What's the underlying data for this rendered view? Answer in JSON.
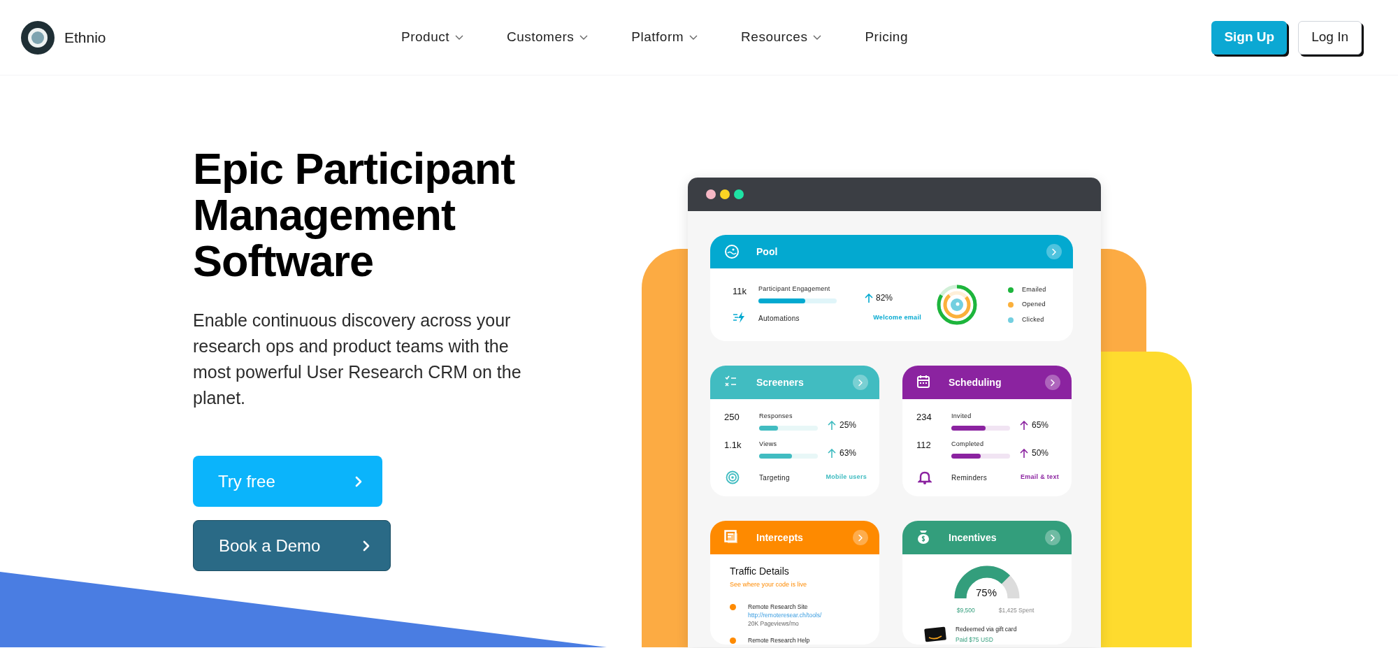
{
  "nav": {
    "brand": "Ethnio",
    "menu": [
      {
        "label": "Product",
        "has_dropdown": true
      },
      {
        "label": "Customers",
        "has_dropdown": true
      },
      {
        "label": "Platform",
        "has_dropdown": true
      },
      {
        "label": "Resources",
        "has_dropdown": true
      },
      {
        "label": "Pricing",
        "has_dropdown": false
      }
    ],
    "actions": [
      {
        "label": "Sign Up",
        "kind": "primary"
      },
      {
        "label": "Log In",
        "kind": "secondary"
      }
    ]
  },
  "hero": {
    "title": "Epic Participant Management Software",
    "description": "Enable continuous discovery across your research ops and product teams with the most powerful User Research CRM on the planet.",
    "buttons": [
      {
        "label": "Try free",
        "kind": "primary"
      },
      {
        "label": "Book a Demo",
        "kind": "secondary"
      }
    ]
  },
  "dashboard": {
    "cards": [
      {
        "kind": "pool",
        "title": "Pool",
        "color": "#03a9d0",
        "value": "11k",
        "label": "Participant Engagement",
        "level": 0.6,
        "change": "82%",
        "footer_label": "Automations",
        "footer_value": "Welcome email",
        "legend": [
          {
            "label": "Emailed",
            "color": "#1db53c"
          },
          {
            "label": "Opened",
            "color": "#fbb03b"
          },
          {
            "label": "Clicked",
            "color": "#73cfe0"
          }
        ]
      },
      {
        "kind": "metrics",
        "title": "Screeners",
        "color": "#41bcc1",
        "metrics": [
          {
            "value": "250",
            "label": "Responses",
            "level": 0.32,
            "change": "25%"
          },
          {
            "value": "1.1k",
            "label": "Views",
            "level": 0.56,
            "change": "63%"
          }
        ],
        "footer_label": "Targeting",
        "footer_value": "Mobile users"
      },
      {
        "kind": "metrics",
        "title": "Scheduling",
        "color": "#8b23a0",
        "metrics": [
          {
            "value": "234",
            "label": "Invited",
            "level": 0.58,
            "change": "65%"
          },
          {
            "value": "112",
            "label": "Completed",
            "level": 0.5,
            "change": "50%"
          }
        ],
        "footer_label": "Reminders",
        "footer_value": "Email & text"
      },
      {
        "kind": "traffic",
        "title": "Intercepts",
        "color": "#fe8a00",
        "heading": "Traffic Details",
        "subheading": "See where your code is live",
        "sites": [
          {
            "name": "Remote Research Site",
            "url": "http://remoteresear.ch/tools/",
            "stat": "20K Pageviews/mo"
          },
          {
            "name": "Remote Research Help"
          }
        ]
      },
      {
        "kind": "budget",
        "title": "Incentives",
        "color": "#339e7c",
        "percent": "75%",
        "budget": "$9,500",
        "spent": "$1,425 Spent",
        "redemption": "Redeemed via gift card",
        "paid": "Paid $75 USD"
      }
    ]
  }
}
